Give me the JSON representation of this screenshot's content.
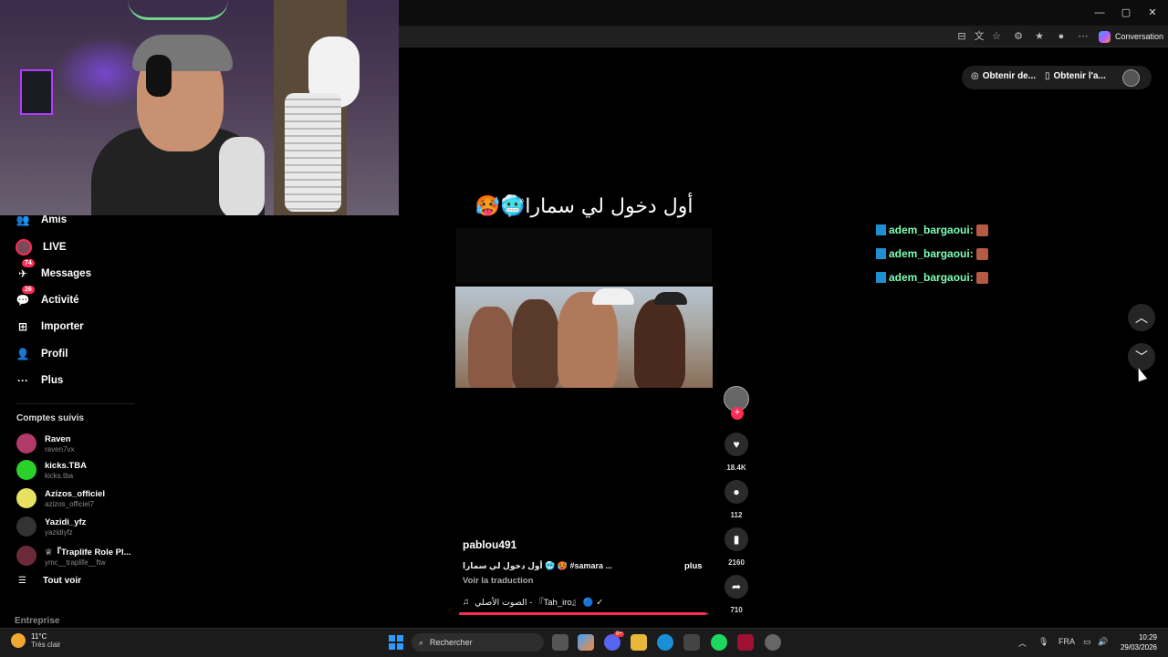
{
  "browser": {
    "conversation_label": "Conversation",
    "min_glyph": "—",
    "max_glyph": "▢",
    "close_glyph": "✕"
  },
  "sidebar": {
    "items": [
      {
        "label": "Amis",
        "icon": "people-icon",
        "glyph": "👥"
      },
      {
        "label": "LIVE",
        "icon": "live-icon",
        "glyph": ""
      },
      {
        "label": "Messages",
        "icon": "messages-icon",
        "glyph": "✈",
        "badge": "74"
      },
      {
        "label": "Activité",
        "icon": "activity-icon",
        "glyph": "💬",
        "badge": "26"
      },
      {
        "label": "Importer",
        "icon": "upload-icon",
        "glyph": "⊞"
      },
      {
        "label": "Profil",
        "icon": "profile-icon",
        "glyph": "👤"
      },
      {
        "label": "Plus",
        "icon": "more-icon",
        "glyph": "···"
      }
    ],
    "following_title": "Comptes suivis",
    "following": [
      {
        "name": "Raven",
        "handle": "raven7vx",
        "color": "#b23a6b"
      },
      {
        "name": "kicks.TBA",
        "handle": "kicks.tba",
        "color": "#2bd12b"
      },
      {
        "name": "Azizos_officiel",
        "handle": "azizos_officiel7",
        "color": "#e8e060"
      },
      {
        "name": "Yazidi_yfz",
        "handle": "yazidiyfz",
        "color": "#333"
      },
      {
        "name": "♕『Traplife Role Pl...",
        "handle": "ymc__traplife__ftw",
        "color": "#6b2a3a"
      }
    ],
    "see_all": "Tout voir",
    "see_all_glyph": "☰",
    "company": "Entreprise"
  },
  "topbar": {
    "get_desktop": "Obtenir de...",
    "get_app": "Obtenir l'a..."
  },
  "video": {
    "caption": "أول دخول لي سمارا🥶🥵",
    "username": "pablou491",
    "description": "أول دخول لي سمارا 🥶 🥵 #samara ...",
    "more": "plus",
    "translate": "Voir la traduction",
    "music": "الصوت الأصلي  -  『Tah_iro』 🔵 ✓",
    "music_glyph": "♫",
    "progress": 0.99,
    "accent": "#fe2c55"
  },
  "actions": {
    "follow_glyph": "+",
    "likes": "18.4K",
    "comments": "112",
    "saves": "2160",
    "shares": "710",
    "like_glyph": "♥",
    "comment_glyph": "●",
    "save_glyph": "▮",
    "share_glyph": "➦"
  },
  "chat": [
    {
      "user": "adem_bargaoui:"
    },
    {
      "user": "adem_bargaoui:"
    },
    {
      "user": "adem_bargaoui:"
    }
  ],
  "nav": {
    "up_glyph": "︿",
    "down_glyph": "﹀"
  },
  "taskbar": {
    "temp": "11°C",
    "weather": "Très clair",
    "search": "Rechercher",
    "search_glyph": "⌕",
    "lang": "FRA",
    "time": "10:29",
    "date": "29/03/2026",
    "discord_badge": "9+"
  }
}
